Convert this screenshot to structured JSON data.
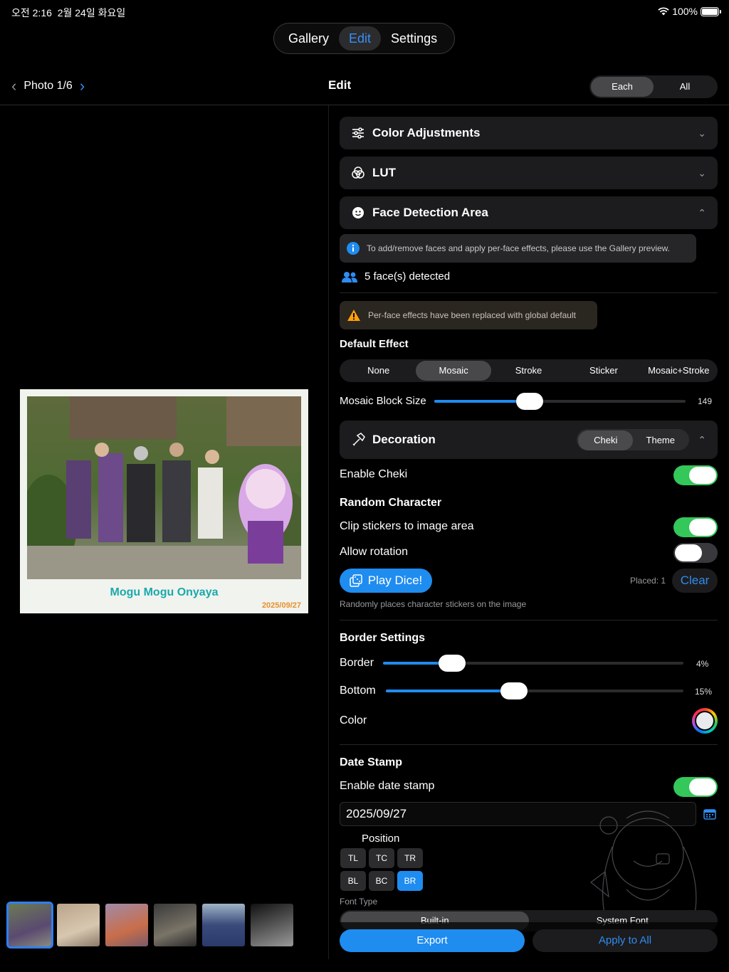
{
  "status": {
    "time": "오전 2:16",
    "date": "2월 24일 화요일",
    "battery": "100%",
    "battery_level": 1.0
  },
  "top_tabs": [
    "Gallery",
    "Edit",
    "Settings"
  ],
  "header": {
    "photo_label": "Photo 1/6",
    "title": "Edit",
    "scope": [
      "Each",
      "All"
    ]
  },
  "preview": {
    "caption": "Mogu Mogu Onyaya",
    "date": "2025/09/27"
  },
  "panel": {
    "color_adjustments": "Color Adjustments",
    "lut": "LUT",
    "face_detection": "Face Detection Area",
    "info_text": "To add/remove faces and apply per-face effects, please use the Gallery preview.",
    "faces_detected": "5 face(s) detected",
    "warning_text": "Per-face effects have been replaced with global default",
    "default_effect_title": "Default Effect",
    "effects": [
      "None",
      "Mosaic",
      "Stroke",
      "Sticker",
      "Mosaic+Stroke"
    ],
    "mosaic_label": "Mosaic Block Size",
    "mosaic_value": "149",
    "mosaic_fraction": 0.38,
    "decoration": "Decoration",
    "decoration_modes": [
      "Cheki",
      "Theme"
    ],
    "enable_cheki": "Enable Cheki",
    "enable_cheki_on": true,
    "random_character": "Random Character",
    "clip_stickers": "Clip stickers to image area",
    "clip_stickers_on": true,
    "allow_rotation": "Allow rotation",
    "allow_rotation_on": false,
    "play_dice": "Play Dice!",
    "placed": "Placed: 1",
    "clear": "Clear",
    "dice_hint": "Randomly places character stickers on the image",
    "border_settings": "Border Settings",
    "border_label": "Border",
    "border_value": "4%",
    "border_fraction": 0.23,
    "bottom_label": "Bottom",
    "bottom_value": "15%",
    "bottom_fraction": 0.43,
    "color_label": "Color",
    "border_color": "#e9eaee",
    "date_stamp": "Date Stamp",
    "enable_date_stamp": "Enable date stamp",
    "enable_date_stamp_on": true,
    "date_value": "2025/09/27",
    "position_label": "Position",
    "positions_top": [
      "TL",
      "TC",
      "TR"
    ],
    "positions_bottom": [
      "BL",
      "BC",
      "BR"
    ],
    "font_type_label": "Font Type",
    "font_types": [
      "Built-in",
      "System Font"
    ],
    "export": "Export",
    "apply_to_all": "Apply to All"
  },
  "colors": {
    "accent": "#1f8cf0",
    "toggle_on": "#34c759",
    "warning": "#ff9f0a"
  }
}
